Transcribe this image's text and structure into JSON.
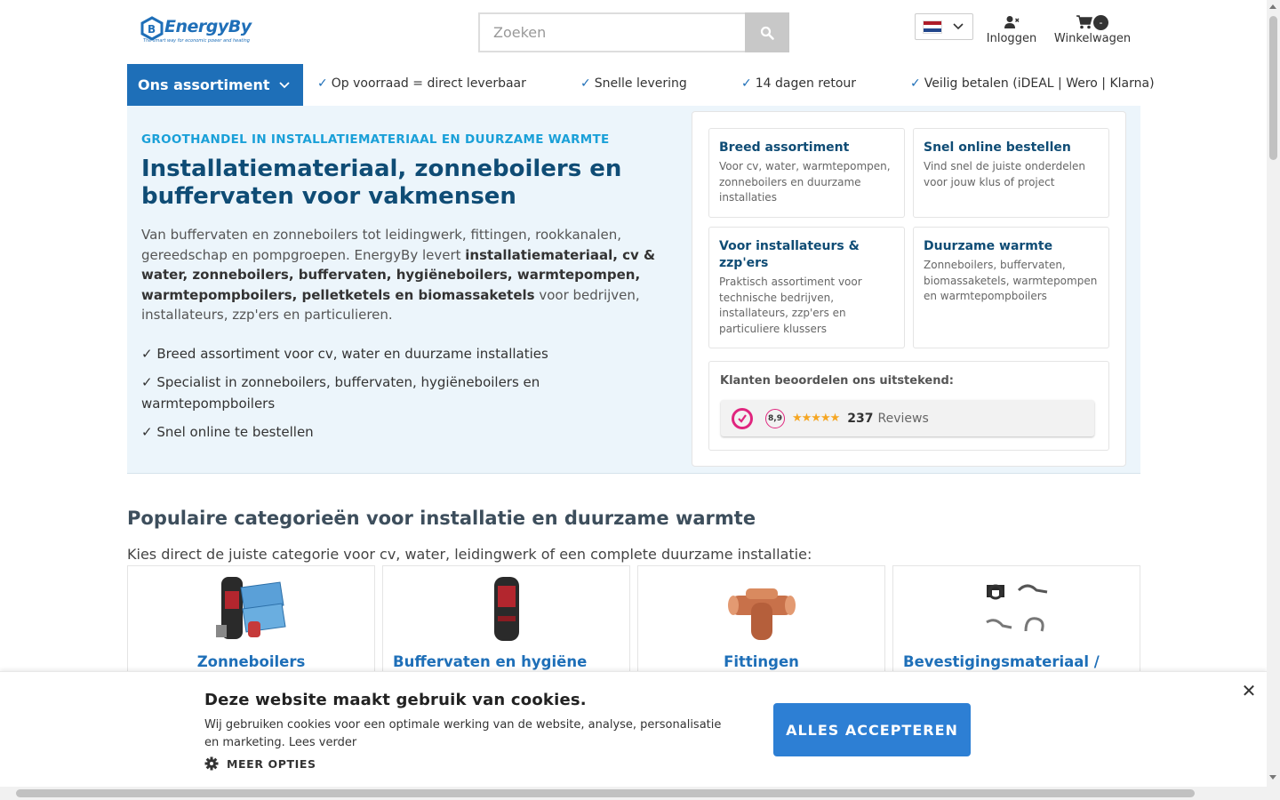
{
  "header": {
    "logo_text": "EnergyBy",
    "logo_tagline": "The smart way for economic power and heating",
    "search_placeholder": "Zoeken",
    "login_label": "Inloggen",
    "cart_label": "Winkelwagen",
    "cart_count": "-"
  },
  "nav": {
    "assortiment_label": "Ons assortiment",
    "usps": [
      "Op voorraad = direct leverbaar",
      "Snelle levering",
      "14 dagen retour",
      "Veilig betalen (iDEAL | Wero | Klarna)"
    ]
  },
  "hero": {
    "eyebrow": "GROOTHANDEL IN INSTALLATIEMATERIAAL EN DUURZAME WARMTE",
    "title": "Installatiemateriaal, zonneboilers en buffervaten voor vakmensen",
    "text_1": "Van buffervaten en zonneboilers tot leidingwerk, fittingen, rookkanalen, gereedschap en pompgroepen. EnergyBy levert ",
    "text_bold": "installatiemateriaal, cv & water, zonneboilers, buffervaten, hygiëneboilers, warmtepompen, warmtepompboilers, pelletketels en biomassaketels",
    "text_2": " voor bedrijven, installateurs, zzp'ers en particulieren.",
    "bullets": [
      "✓ Breed assortiment voor cv, water en duurzame installaties",
      "✓ Specialist in zonneboilers, buffervaten, hygiëneboilers en warmtepompboilers",
      "✓ Snel online te bestellen"
    ]
  },
  "features": [
    {
      "title": "Breed assortiment",
      "desc": "Voor cv, water, warmtepompen, zonneboilers en duurzame installaties"
    },
    {
      "title": "Snel online bestellen",
      "desc": "Vind snel de juiste onderdelen voor jouw klus of project"
    },
    {
      "title": "Voor installateurs & zzp'ers",
      "desc": "Praktisch assortiment voor technische bedrijven, installateurs, zzp'ers en particuliere klussers"
    },
    {
      "title": "Duurzame warmte",
      "desc": "Zonneboilers, buffervaten, biomassaketels, warmtepompen en warmtepompboilers"
    }
  ],
  "reviews": {
    "title": "Klanten beoordelen ons uitstekend:",
    "score": "8,9",
    "stars": "★★★★★",
    "count": "237",
    "label": "Reviews"
  },
  "categories": {
    "title": "Populaire categorieën voor installatie en duurzame warmte",
    "subtitle": "Kies direct de juiste categorie voor cv, water, leidingwerk of een complete duurzame installatie:",
    "items": [
      {
        "name": "Zonneboilers"
      },
      {
        "name": "Buffervaten en hygiëne"
      },
      {
        "name": "Fittingen"
      },
      {
        "name": "Bevestigingsmateriaal /"
      }
    ]
  },
  "cookie": {
    "title": "Deze website maakt gebruik van cookies.",
    "text": "Wij gebruiken cookies voor een optimale werking van de website, analyse, personalisatie en marketing. Lees verder",
    "more_options": "MEER OPTIES",
    "accept": "ALLES ACCEPTEREN",
    "close": "✕"
  },
  "colors": {
    "brand_blue": "#1e6fb8",
    "hero_bg": "#ecf5fb",
    "eyebrow": "#1aa0d8",
    "title": "#0f4c75",
    "accept_button": "#2d7fd4"
  }
}
